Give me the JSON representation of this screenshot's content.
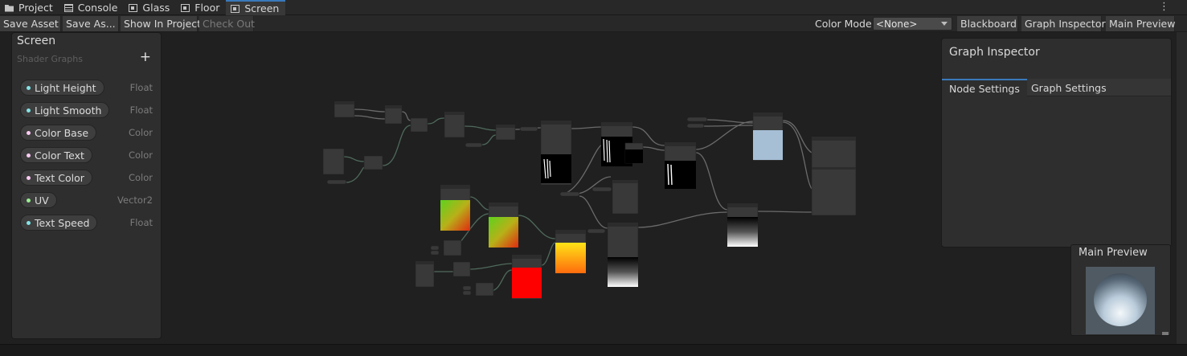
{
  "tabs": [
    {
      "label": "Project",
      "icon": "folder-icon"
    },
    {
      "label": "Console",
      "icon": "console-icon"
    },
    {
      "label": "Glass",
      "icon": "shader-graph-icon"
    },
    {
      "label": "Floor",
      "icon": "shader-graph-icon"
    },
    {
      "label": "Screen",
      "icon": "shader-graph-icon",
      "active": true
    }
  ],
  "toolbar": {
    "save_asset": "Save Asset",
    "save_as": "Save As...",
    "show_in_project": "Show In Project",
    "check_out": "Check Out",
    "color_mode_label": "Color Mode",
    "color_mode_value": "<None>",
    "blackboard": "Blackboard",
    "graph_inspector": "Graph Inspector",
    "main_preview": "Main Preview"
  },
  "blackboard": {
    "title": "Screen",
    "subtitle": "Shader Graphs",
    "add": "+",
    "properties": [
      {
        "name": "Light Height",
        "type": "Float"
      },
      {
        "name": "Light Smooth",
        "type": "Float"
      },
      {
        "name": "Color Base",
        "type": "Color"
      },
      {
        "name": "Color Text",
        "type": "Color"
      },
      {
        "name": "Text Color",
        "type": "Color"
      },
      {
        "name": "UV",
        "type": "Vector2"
      },
      {
        "name": "Text Speed",
        "type": "Float"
      }
    ]
  },
  "inspector": {
    "title": "Graph Inspector",
    "tabs": [
      "Node Settings",
      "Graph Settings"
    ]
  },
  "main_preview": {
    "title": "Main Preview"
  },
  "colors": {
    "accent": "#3a79bb",
    "float_port": "#84e4e7",
    "color_port": "#fbcbf4",
    "vector2_port": "#9aef92"
  }
}
